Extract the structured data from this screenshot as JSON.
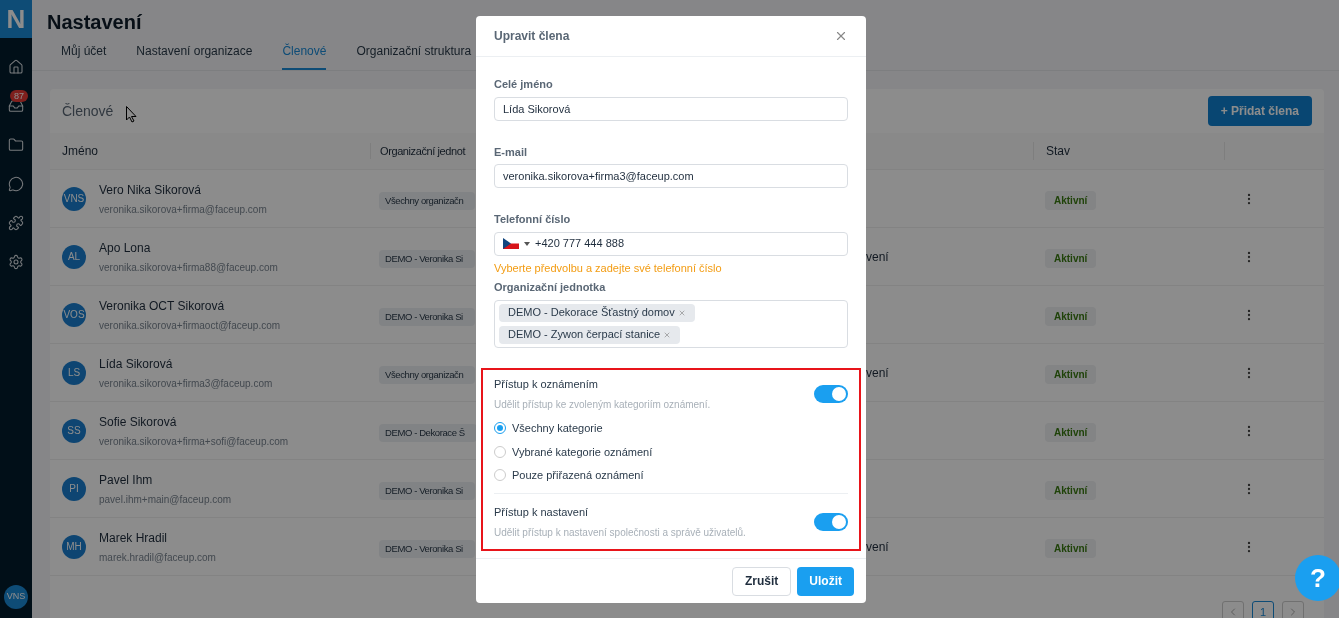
{
  "sidebar": {
    "logo": "N",
    "badge": "87",
    "avatar": "VNS"
  },
  "page": {
    "title": "Nastavení",
    "tabs": [
      {
        "label": "Můj účet",
        "selected": false
      },
      {
        "label": "Nastavení organizace",
        "selected": false
      },
      {
        "label": "Členové",
        "selected": true
      },
      {
        "label": "Organizační struktura",
        "selected": false
      }
    ]
  },
  "members_card": {
    "title": "Členové",
    "add_button": "+ Přidat člena",
    "table": {
      "columns": [
        "Jméno",
        "Organizační jednot",
        "Stav"
      ],
      "rows": [
        {
          "initials": "VNS",
          "name": "Vero Nika Sikorová",
          "email": "veronika.sikorova+firma@faceup.com",
          "unit": "Všechny organizačn",
          "status": "Aktivní"
        },
        {
          "initials": "AL",
          "name": "Apo Lona",
          "email": "veronika.sikorova+firma88@faceup.com",
          "unit": "DEMO - Veronika Si",
          "column_3": "vení",
          "status": "Aktivní"
        },
        {
          "initials": "VOS",
          "name": "Veronika OCT Sikorová",
          "email": "veronika.sikorova+firmaoct@faceup.com",
          "unit": "DEMO - Veronika Si",
          "status": "Aktivní"
        },
        {
          "initials": "LS",
          "name": "Lída Sikorová",
          "email": "veronika.sikorova+firma3@faceup.com",
          "unit": "Všechny organizačn",
          "column_3": "vení",
          "status": "Aktivní"
        },
        {
          "initials": "SS",
          "name": "Sofie Sikorová",
          "email": "veronika.sikorova+firma+sofi@faceup.com",
          "unit": "DEMO - Dekorace Š",
          "status": "Aktivní"
        },
        {
          "initials": "PI",
          "name": "Pavel Ihm",
          "email": "pavel.ihm+main@faceup.com",
          "unit": "DEMO - Veronika Si",
          "status": "Aktivní"
        },
        {
          "initials": "MH",
          "name": "Marek Hradil",
          "email": "marek.hradil@faceup.com",
          "unit": "DEMO - Veronika Si",
          "column_3": "vení",
          "status": "Aktivní"
        }
      ]
    },
    "pagination": {
      "pages": [
        {
          "label": "1",
          "selected": true
        }
      ]
    }
  },
  "modal": {
    "title": "Upravit člena",
    "full_name": {
      "label": "Celé jméno",
      "value": "Lída Sikorová"
    },
    "email": {
      "label": "E-mail",
      "value": "veronika.sikorova+firma3@faceup.com"
    },
    "phone": {
      "label": "Telefonní číslo",
      "value": "+420 777 444 888",
      "hint": "Vyberte předvolbu a zadejte své telefonní číslo"
    },
    "org_unit": {
      "label": "Organizační jednotka",
      "tags": [
        "DEMO - Dekorace Šťastný domov",
        "DEMO - Zywon čerpací stanice"
      ]
    },
    "notifications_access": {
      "title": "Přístup k oznámením",
      "description": "Udělit přístup ke zvoleným kategoriím oznámení.",
      "on": true,
      "options": [
        {
          "label": "Všechny kategorie",
          "selected": true
        },
        {
          "label": "Vybrané kategorie oznámení",
          "selected": false
        },
        {
          "label": "Pouze přiřazená oznámení",
          "selected": false
        }
      ]
    },
    "settings_access": {
      "title": "Přístup k nastavení",
      "description": "Udělit přístup k nastavení společnosti a správě uživatelů.",
      "on": true
    },
    "buttons": {
      "cancel": "Zrušit",
      "save": "Uložit"
    }
  },
  "help_button": "?"
}
